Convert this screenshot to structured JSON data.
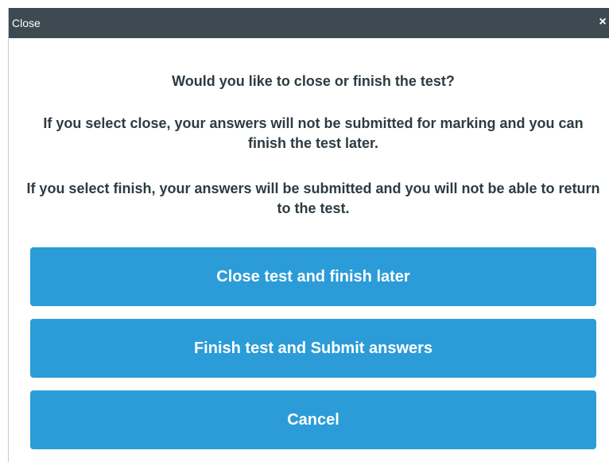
{
  "dialog": {
    "title": "Close",
    "close_icon_glyph": "×",
    "close_icon": "close-icon",
    "question": "Would you like to close or finish the test?",
    "close_info": "If you select close, your answers will not be submitted for marking and you can finish the test later.",
    "finish_info": "If you select finish, your answers will be submitted and you will not be able to return to the test."
  },
  "buttons": {
    "close_later": "Close test and finish later",
    "finish_submit": "Finish test and Submit answers",
    "cancel": "Cancel"
  },
  "colors": {
    "titlebar_bg": "#3d4a52",
    "button_bg": "#2b9cd8",
    "text": "#2e3b42"
  }
}
